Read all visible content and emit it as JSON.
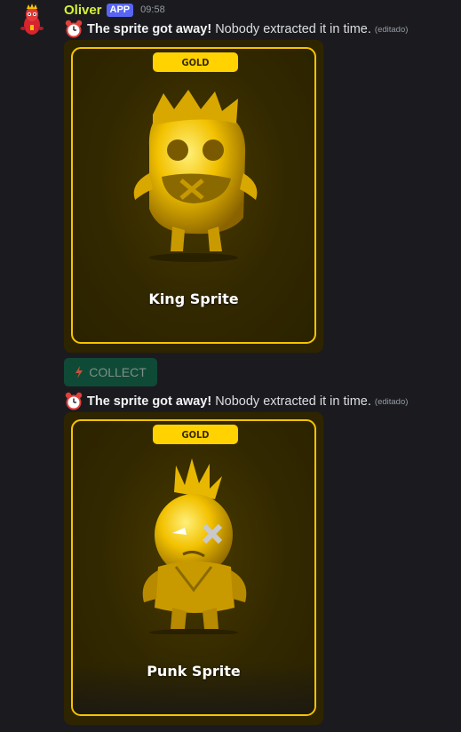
{
  "author": {
    "name": "Oliver",
    "badge": "APP",
    "time": "09:58",
    "name_color": "#d7f13a"
  },
  "messages": [
    {
      "bold": "The sprite got away!",
      "text": "Nobody extracted it in time.",
      "edited": "(editado)",
      "icon": "alarm-clock-icon"
    },
    {
      "bold": "The sprite got away!",
      "text": "Nobody extracted it in time.",
      "edited": "(editado)",
      "icon": "alarm-clock-icon"
    }
  ],
  "cards": [
    {
      "rarity": "GOLD",
      "name": "King Sprite",
      "border_color": "#f6c400",
      "art": "gold-king-sprite-image"
    },
    {
      "rarity": "GOLD",
      "name": "Punk Sprite",
      "border_color": "#f6c400",
      "art": "gold-punk-sprite-image"
    }
  ],
  "collect_button": {
    "label": "COLLECT",
    "icon": "lightning-icon",
    "color": "#0f4a37"
  }
}
